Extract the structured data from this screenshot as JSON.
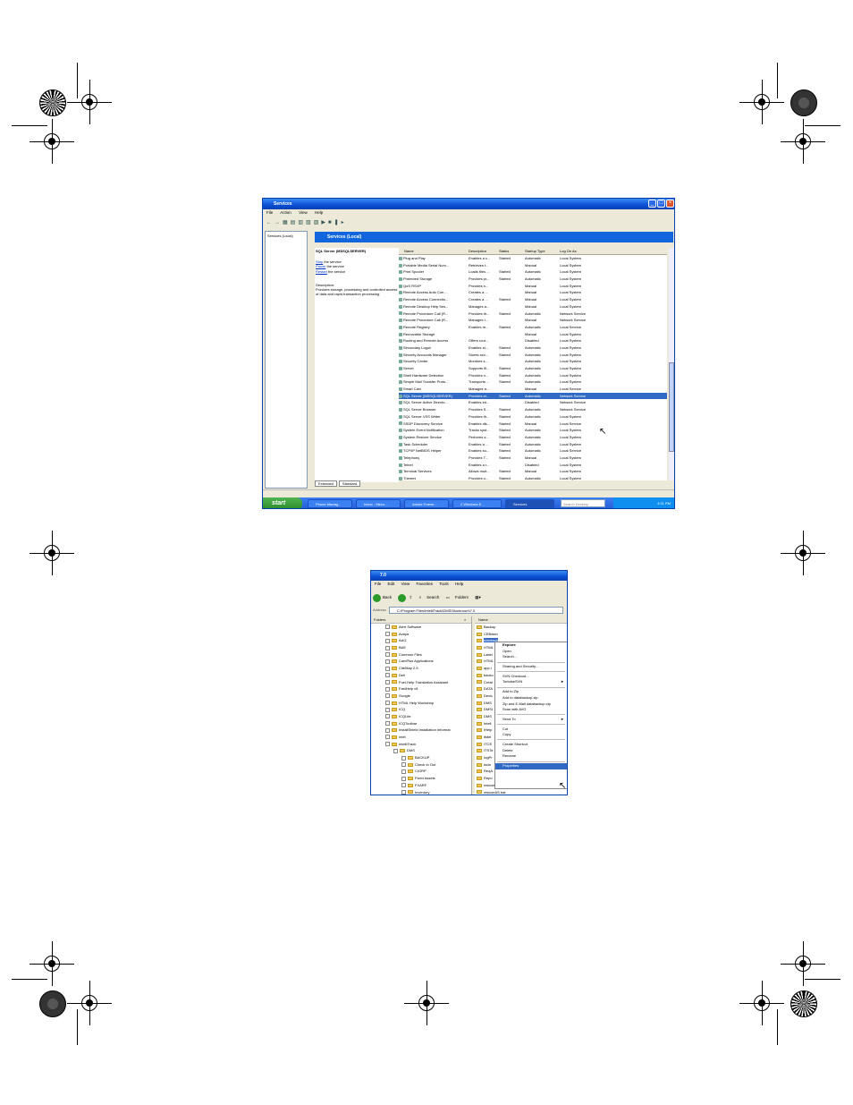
{
  "services_window": {
    "title": "Services",
    "menu": [
      "File",
      "Action",
      "View",
      "Help"
    ],
    "tree_root": "Services (Local)",
    "banner": "Services (Local)",
    "selected_service": "SQL Server (MSSQLSERVER)",
    "actions": {
      "stop": "Stop",
      "stop_rest": " the service",
      "pause": "Pause",
      "pause_rest": " the service",
      "restart": "Restart",
      "restart_rest": " the service"
    },
    "description_label": "Description:",
    "description_text": "Provides storage, processing and controlled access of data and rapid transaction processing.",
    "columns": [
      "Name",
      "Description",
      "Status",
      "Startup Type",
      "Log On As"
    ],
    "rows": [
      [
        "Plug and Play",
        "Enables a c...",
        "Started",
        "Automatic",
        "Local System"
      ],
      [
        "Portable Media Serial Num...",
        "Retrieves t...",
        "",
        "Manual",
        "Local System"
      ],
      [
        "Print Spooler",
        "Loads files ...",
        "Started",
        "Automatic",
        "Local System"
      ],
      [
        "Protected Storage",
        "Provides pr...",
        "Started",
        "Automatic",
        "Local System"
      ],
      [
        "QoS RSVP",
        "Provides n...",
        "",
        "Manual",
        "Local System"
      ],
      [
        "Remote Access Auto Con...",
        "Creates a ...",
        "",
        "Manual",
        "Local System"
      ],
      [
        "Remote Access Connectio...",
        "Creates a ...",
        "Started",
        "Manual",
        "Local System"
      ],
      [
        "Remote Desktop Help Ses...",
        "Manages a...",
        "",
        "Manual",
        "Local System"
      ],
      [
        "Remote Procedure Call (R...",
        "Provides th...",
        "Started",
        "Automatic",
        "Network Service"
      ],
      [
        "Remote Procedure Call (R...",
        "Manages t...",
        "",
        "Manual",
        "Network Service"
      ],
      [
        "Remote Registry",
        "Enables re...",
        "Started",
        "Automatic",
        "Local Service"
      ],
      [
        "Removable Storage",
        "",
        "",
        "Manual",
        "Local System"
      ],
      [
        "Routing and Remote Access",
        "Offers rout...",
        "",
        "Disabled",
        "Local System"
      ],
      [
        "Secondary Logon",
        "Enables st...",
        "Started",
        "Automatic",
        "Local System"
      ],
      [
        "Security Accounts Manager",
        "Stores sec...",
        "Started",
        "Automatic",
        "Local System"
      ],
      [
        "Security Center",
        "Monitors s...",
        "",
        "Automatic",
        "Local System"
      ],
      [
        "Server",
        "Supports fil...",
        "Started",
        "Automatic",
        "Local System"
      ],
      [
        "Shell Hardware Detection",
        "Provides n...",
        "Started",
        "Automatic",
        "Local System"
      ],
      [
        "Simple Mail Transfer Proto...",
        "Transports ...",
        "Started",
        "Automatic",
        "Local System"
      ],
      [
        "Smart Card",
        "Manages a...",
        "",
        "Manual",
        "Local Service"
      ],
      [
        "SQL Server (MSSQLSERVER)",
        "Provides st...",
        "Started",
        "Automatic",
        "Network Service"
      ],
      [
        "SQL Server Active Directo...",
        "Enables int...",
        "",
        "Disabled",
        "Network Service"
      ],
      [
        "SQL Server Browser",
        "Provides S...",
        "Started",
        "Automatic",
        "Network Service"
      ],
      [
        "SQL Server VSS Writer",
        "Provides th...",
        "Started",
        "Automatic",
        "Local System"
      ],
      [
        "SSDP Discovery Service",
        "Enables dis...",
        "Started",
        "Manual",
        "Local Service"
      ],
      [
        "System Event Notification",
        "Tracks syst...",
        "Started",
        "Automatic",
        "Local System"
      ],
      [
        "System Restore Service",
        "Performs s...",
        "Started",
        "Automatic",
        "Local System"
      ],
      [
        "Task Scheduler",
        "Enables a ...",
        "Started",
        "Automatic",
        "Local System"
      ],
      [
        "TCP/IP NetBIOS Helper",
        "Enables su...",
        "Started",
        "Automatic",
        "Local Service"
      ],
      [
        "Telephony",
        "Provides T...",
        "Started",
        "Manual",
        "Local System"
      ],
      [
        "Telnet",
        "Enables a r...",
        "",
        "Disabled",
        "Local System"
      ],
      [
        "Terminal Services",
        "Allows mult...",
        "Started",
        "Manual",
        "Local System"
      ],
      [
        "Themes",
        "Provides u...",
        "Started",
        "Automatic",
        "Local System"
      ]
    ],
    "selected_row": 20,
    "tabs": [
      "Extended",
      "Standard"
    ],
    "taskbar": {
      "start": "start",
      "tasks": [
        "Phone Manag...",
        "Inbox - Micro...",
        "Adobe Frame...",
        "2 Windows E...",
        "Services"
      ],
      "search_placeholder": "Search Desktop",
      "clock": "4:31 PM"
    }
  },
  "explorer_window": {
    "title": "7.0",
    "menu": [
      "File",
      "Edit",
      "View",
      "Favorites",
      "Tools",
      "Help"
    ],
    "toolbar": {
      "back": "Back",
      "search": "Search",
      "folders": "Folders"
    },
    "address_label": "Address",
    "address": "C:\\Program Files\\IntelliTrack\\DMS\\Stockroom\\7.0",
    "folders_header": "Folders",
    "name_header": "Name",
    "folders": [
      {
        "label": "Alert Software",
        "indent": 1
      },
      {
        "label": "Avaya",
        "indent": 1
      },
      {
        "label": "AAG",
        "indent": 1
      },
      {
        "label": "BAE",
        "indent": 1
      },
      {
        "label": "Common Files",
        "indent": 1
      },
      {
        "label": "CamPlus Applications",
        "indent": 1
      },
      {
        "label": "CiteMap 2.5",
        "indent": 1
      },
      {
        "label": "Dell",
        "indent": 1
      },
      {
        "label": "Fuel-Help Translation Assistant",
        "indent": 1
      },
      {
        "label": "FastHelp v5",
        "indent": 1
      },
      {
        "label": "Google",
        "indent": 1
      },
      {
        "label": "HTML Help Workshop",
        "indent": 1
      },
      {
        "label": "ICQ",
        "indent": 1
      },
      {
        "label": "ICQLite",
        "indent": 1
      },
      {
        "label": "ICQToolbar",
        "indent": 1
      },
      {
        "label": "InstallShield Installation Informat",
        "indent": 1
      },
      {
        "label": "Intel",
        "indent": 1
      },
      {
        "label": "IntelliTrack",
        "indent": 1
      },
      {
        "label": "DMS",
        "indent": 2
      },
      {
        "label": "BACKUP",
        "indent": 3
      },
      {
        "label": "Check In Out",
        "indent": 3
      },
      {
        "label": "CIORP",
        "indent": 3
      },
      {
        "label": "Fixed Assets",
        "indent": 3
      },
      {
        "label": "FXARF",
        "indent": 3
      },
      {
        "label": "Inventory",
        "indent": 3
      }
    ],
    "files": [
      "Backup",
      "CEBatch",
      "databack",
      "HTML",
      "Label",
      "HTML",
      "app.i",
      "backu",
      "Creat",
      "DATA",
      "Devic",
      "DMS",
      "DMSI",
      "DMS",
      "Intell",
      "IHelp",
      "itidel",
      "ITCE",
      "ITSTe",
      "IogPr",
      "iscIn",
      "ReqA",
      "Repo",
      "restorebat",
      "restoreAS.bat"
    ],
    "selected_file": 2,
    "context_menu": [
      {
        "label": "Explore",
        "bold": true
      },
      {
        "label": "Open"
      },
      {
        "label": "Search..."
      },
      {
        "sep": true
      },
      {
        "label": "Sharing and Security..."
      },
      {
        "sep": true
      },
      {
        "label": "SVN Checkout..."
      },
      {
        "label": "TortoiseSVN",
        "arrow": "►"
      },
      {
        "sep": true
      },
      {
        "label": "Add to Zip"
      },
      {
        "label": "Add to databackup.zip"
      },
      {
        "label": "Zip and E-Mail databackup.zip"
      },
      {
        "label": "Scan with AVG"
      },
      {
        "sep": true
      },
      {
        "label": "Send To",
        "arrow": "►"
      },
      {
        "sep": true
      },
      {
        "label": "Cut"
      },
      {
        "label": "Copy"
      },
      {
        "sep": true
      },
      {
        "label": "Create Shortcut"
      },
      {
        "label": "Delete"
      },
      {
        "label": "Rename"
      },
      {
        "sep": true
      },
      {
        "label": "Properties",
        "highlight": true
      }
    ]
  },
  "colors": {
    "xp_blue": "#0a4fd6",
    "selection": "#316ac5",
    "taskbar": "#2459d6",
    "start_green": "#2a8a2a"
  }
}
